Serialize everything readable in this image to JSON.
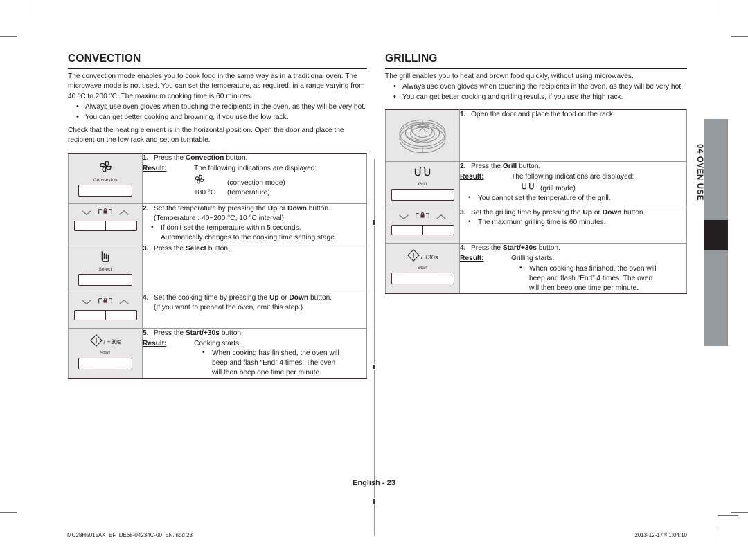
{
  "left": {
    "title": "CONVECTION",
    "intro": "The convection mode enables you to cook food in the same way as in a traditional oven. The microwave mode is not used. You can set the temperature, as required, in a range varying from 40 °C to 200 °C. The maximum cooking time is 60 minutes.",
    "bullets": [
      "Always use oven gloves when touching the recipients in the oven, as they will be very hot.",
      "You can get better cooking and browning, if you use the low rack."
    ],
    "outro": "Check that the heating element is in the horizontal position. Open the door and place the recipient on the low rack and set on turntable.",
    "steps": [
      {
        "num": "1.",
        "key": {
          "type": "button",
          "icon": "convection-fan-icon",
          "label": "Convection"
        },
        "lead_pre": "Press the ",
        "lead_bold": "Convection",
        "lead_post": " button.",
        "result_label": "Result:",
        "result_value": "The following indications are displayed:",
        "icon_lines": [
          {
            "icon": "convection-fan-icon",
            "text": "(convection mode)"
          },
          {
            "icon": "180 °C",
            "text": "(temperature)"
          }
        ]
      },
      {
        "num": "2.",
        "key": {
          "type": "updown",
          "icon": "up-down-lock-icon"
        },
        "lead_pre": "Set the temperature by pressing the ",
        "lead_bold": "Up",
        "lead_mid": " or ",
        "lead_bold2": "Down",
        "lead_post": " button.",
        "sub_plain": "(Temperature : 40~200 °C, 10 °C interval)",
        "sub_bullets": [
          {
            "first": "If don't set the temperature within 5 seconds,",
            "cont": "Automatically changes to the cooking time setting stage."
          }
        ]
      },
      {
        "num": "3.",
        "key": {
          "type": "button",
          "icon": "select-hand-icon",
          "label": "Select"
        },
        "lead_pre": "Press the ",
        "lead_bold": "Select",
        "lead_post": " button."
      },
      {
        "num": "4.",
        "key": {
          "type": "updown",
          "icon": "up-down-lock-icon"
        },
        "lead_pre": "Set the cooking time by pressing the ",
        "lead_bold": "Up",
        "lead_mid": " or ",
        "lead_bold2": "Down",
        "lead_post": " button.",
        "sub_plain": "(If you want to preheat the oven, omit this step.)"
      },
      {
        "num": "5.",
        "key": {
          "type": "start",
          "icon": "start-power-icon",
          "suffix": "/ +30s",
          "label": "Start"
        },
        "lead_pre": "Press the ",
        "lead_bold": "Start/+30s",
        "lead_post": " button.",
        "result_label": "Result:",
        "result_value": "Cooking starts.",
        "deep_bullets": [
          {
            "first": "When cooking has finished, the oven will",
            "cont": [
              "beep and flash “End” 4 times. The oven",
              "will then beep one time per minute."
            ]
          }
        ]
      }
    ]
  },
  "right": {
    "title": "GRILLING",
    "intro": "The grill enables you to heat and brown food quickly, without using microwaves.",
    "bullets": [
      "Always use oven gloves when touching the recipients in the oven, as they will be very hot.",
      "You can get better cooking and grilling results, if you use the high rack."
    ],
    "steps": [
      {
        "num": "1.",
        "key": {
          "type": "illustration",
          "icon": "turntable-rack-illustration"
        },
        "lead_pre": "Open the door and place the food on the rack.",
        "lead_bold": "",
        "lead_post": ""
      },
      {
        "num": "2.",
        "key": {
          "type": "button",
          "icon": "grill-element-icon",
          "label": "Grill"
        },
        "lead_pre": "Press the ",
        "lead_bold": "Grill",
        "lead_post": " button.",
        "result_label": "Result:",
        "result_value": "The following indications are displayed:",
        "icon_lines": [
          {
            "icon": "grill-element-icon",
            "text": "(grill mode)"
          }
        ],
        "sub_bullets": [
          {
            "first": "You cannot set the temperature of the grill."
          }
        ]
      },
      {
        "num": "3.",
        "key": {
          "type": "updown",
          "icon": "up-down-lock-icon"
        },
        "lead_pre": "Set the grilling time by pressing the ",
        "lead_bold": "Up",
        "lead_mid": " or ",
        "lead_bold2": "Down",
        "lead_post": " button.",
        "sub_bullets": [
          {
            "first": "The maximum grilling time is 60 minutes."
          }
        ]
      },
      {
        "num": "4.",
        "key": {
          "type": "start",
          "icon": "start-power-icon",
          "suffix": "/ +30s",
          "label": "Start"
        },
        "lead_pre": "Press the ",
        "lead_bold": "Start/+30s",
        "lead_post": " button.",
        "result_label": "Result:",
        "result_value": "Grilling starts.",
        "deep_bullets": [
          {
            "first": "When cooking has finished, the oven will",
            "cont": [
              "beep and flash “End” 4 times. The oven",
              "will then beep one time per minute."
            ]
          }
        ]
      }
    ]
  },
  "tab": {
    "label": "04  OVEN USE"
  },
  "footer": {
    "page_label": "English - 23",
    "file_name": "MC28H5015AK_EF_DE68-04234C-00_EN.indd   23",
    "timestamp": "2013-12-17   ᴿ 1:04:10"
  },
  "colors": {
    "key_cell_bg": "#e7e7e7",
    "key_border": "#4a2a35",
    "tab_bar": "#949a9e",
    "tab_block": "#231f20",
    "text": "#231f20"
  }
}
